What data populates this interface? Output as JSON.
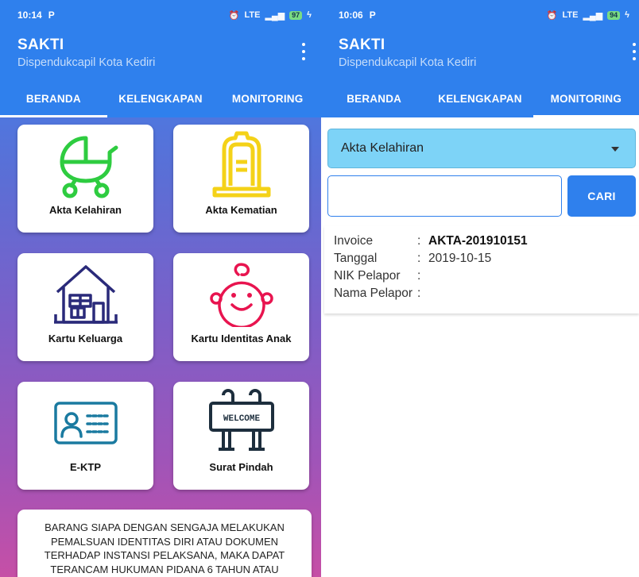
{
  "left": {
    "status": {
      "time": "10:14",
      "app_glyph": "P",
      "network": "LTE",
      "battery": "97"
    },
    "app_title": "SAKTI",
    "app_subtitle": "Dispendukcapil Kota Kediri",
    "tabs": [
      {
        "label": "BERANDA",
        "active": true
      },
      {
        "label": "KELENGKAPAN",
        "active": false
      },
      {
        "label": "MONITORING",
        "active": false
      }
    ],
    "cards": [
      {
        "label": "Akta Kelahiran",
        "icon": "stroller-icon",
        "icon_color": "#2ecc40"
      },
      {
        "label": "Akta Kematian",
        "icon": "gravestone-icon",
        "icon_color": "#f4d218"
      },
      {
        "label": "Kartu Keluarga",
        "icon": "house-icon",
        "icon_color": "#2a2a7a"
      },
      {
        "label": "Kartu Identitas Anak",
        "icon": "baby-face-icon",
        "icon_color": "#e8144f"
      },
      {
        "label": "E-KTP",
        "icon": "id-card-icon",
        "icon_color": "#1a7aa0"
      },
      {
        "label": "Surat Pindah",
        "icon": "welcome-sign-icon",
        "icon_color": "#1d2e3d",
        "sign_text": "WELCOME"
      }
    ],
    "notice": "BARANG SIAPA DENGAN SENGAJA MELAKUKAN PEMALSUAN IDENTITAS DIRI ATAU DOKUMEN TERHADAP INSTANSI PELAKSANA, MAKA DAPAT TERANCAM HUKUMAN PIDANA 6 TAHUN ATAU"
  },
  "right": {
    "status": {
      "time": "10:06",
      "app_glyph": "P",
      "network": "LTE",
      "battery": "94"
    },
    "app_title": "SAKTI",
    "app_subtitle": "Dispendukcapil Kota Kediri",
    "tabs": [
      {
        "label": "BERANDA",
        "active": false
      },
      {
        "label": "KELENGKAPAN",
        "active": false
      },
      {
        "label": "MONITORING",
        "active": true
      }
    ],
    "dropdown_value": "Akta Kelahiran",
    "search": {
      "value": "",
      "placeholder": "",
      "button_label": "CARI"
    },
    "result": [
      {
        "key": "Invoice",
        "sep": ":",
        "value": "AKTA-201910151",
        "bold": true
      },
      {
        "key": "Tanggal",
        "sep": ":",
        "value": "2019-10-15",
        "bold": false
      },
      {
        "key": "NIK Pelapor",
        "sep": ":",
        "value": "",
        "bold": false
      },
      {
        "key": "Nama Pelapor",
        "sep": ":",
        "value": "",
        "bold": false
      }
    ]
  },
  "colors": {
    "primary": "#2f80ed",
    "dropdown_bg": "#7dd3f7"
  }
}
